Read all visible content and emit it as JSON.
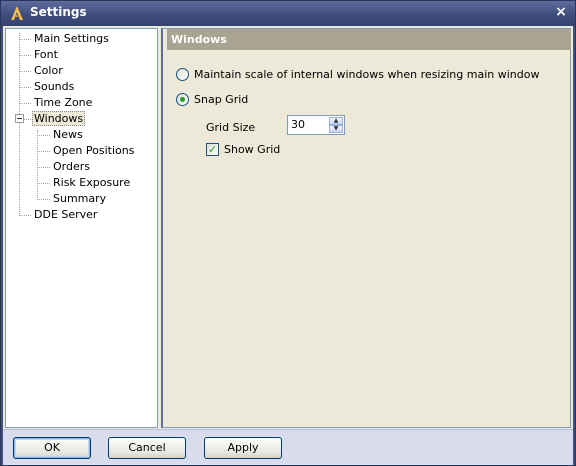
{
  "window": {
    "title": "Settings",
    "logo_icon": "app-logo-icon",
    "close_glyph": "×"
  },
  "tree": {
    "items": [
      {
        "label": "Main Settings"
      },
      {
        "label": "Font"
      },
      {
        "label": "Color"
      },
      {
        "label": "Sounds"
      },
      {
        "label": "Time Zone"
      },
      {
        "label": "Windows",
        "selected": true,
        "expanded": true
      },
      {
        "label": "News"
      },
      {
        "label": "Open Positions"
      },
      {
        "label": "Orders"
      },
      {
        "label": "Risk Exposure"
      },
      {
        "label": "Summary"
      },
      {
        "label": "DDE Server"
      }
    ]
  },
  "panel": {
    "header": "Windows",
    "maintain_scale_label": "Maintain scale of internal windows when resizing main window",
    "maintain_scale_checked": false,
    "snap_grid_label": "Snap Grid",
    "snap_grid_checked": true,
    "grid_size_label": "Grid Size",
    "grid_size_value": "30",
    "show_grid_label": "Show Grid",
    "show_grid_checked": true
  },
  "buttons": {
    "ok": "OK",
    "cancel": "Cancel",
    "apply": "Apply"
  },
  "colors": {
    "title_bar": "#3f4f7e",
    "panel_header": "#a9a391",
    "radio_dot": "#21a121"
  }
}
